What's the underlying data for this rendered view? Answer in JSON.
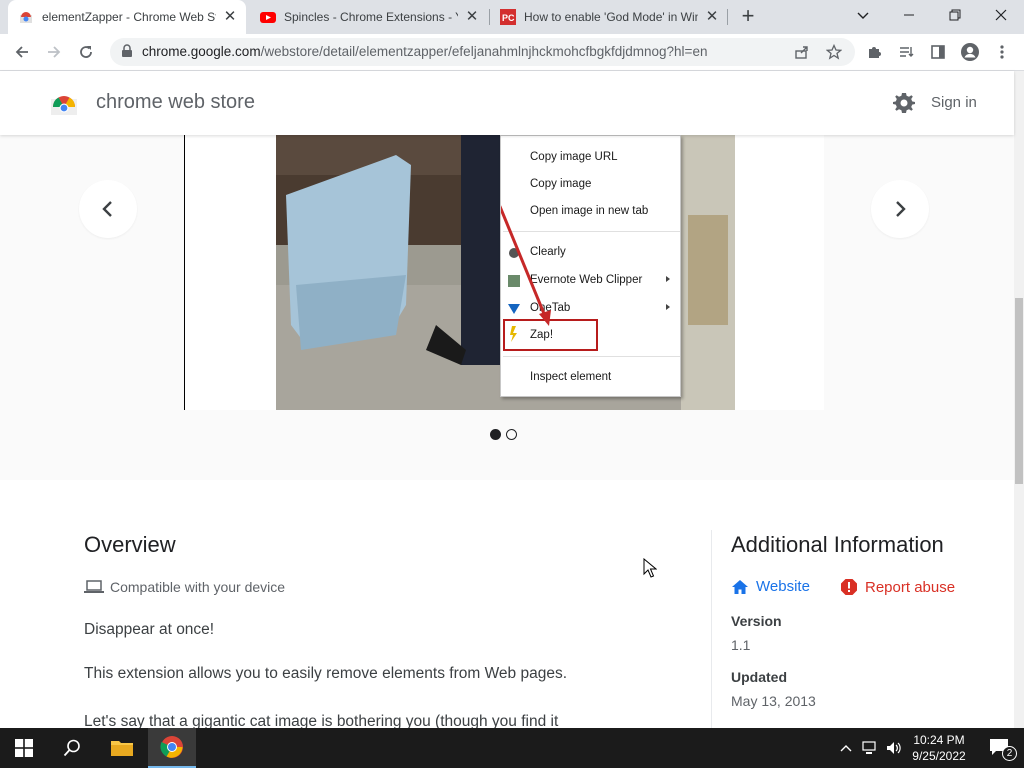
{
  "browser": {
    "tabs": [
      {
        "title": "elementZapper - Chrome Web Store",
        "active": true
      },
      {
        "title": "Spincles - Chrome Extensions - YouTube",
        "active": false
      },
      {
        "title": "How to enable 'God Mode' in Windows",
        "active": false
      }
    ],
    "url_host": "chrome.google.com",
    "url_path": "/webstore/detail/elementzapper/efeljanahmlnjhckmohcfbgkfdjdmnog?hl=en"
  },
  "store": {
    "name": "chrome web store",
    "sign_in": "Sign in"
  },
  "screenshot_menu": {
    "items": [
      "Copy image URL",
      "Copy image",
      "Open image in new tab",
      "Clearly",
      "Evernote Web Clipper",
      "OneTab",
      "Zap!",
      "Inspect element"
    ]
  },
  "overview": {
    "title": "Overview",
    "compat": "Compatible with your device",
    "p1": "Disappear at once!",
    "p2": "This extension allows you to easily remove elements from Web pages.",
    "p3": "Let's say that a gigantic cat image is bothering you (though you find it"
  },
  "additional": {
    "title": "Additional Information",
    "website": "Website",
    "report": "Report abuse",
    "version_label": "Version",
    "version": "1.1",
    "updated_label": "Updated",
    "updated": "May 13, 2013"
  },
  "taskbar": {
    "time": "10:24 PM",
    "date": "9/25/2022",
    "notif_count": "2"
  },
  "colors": {
    "link_blue": "#1a73e8",
    "report_red": "#d93025"
  }
}
